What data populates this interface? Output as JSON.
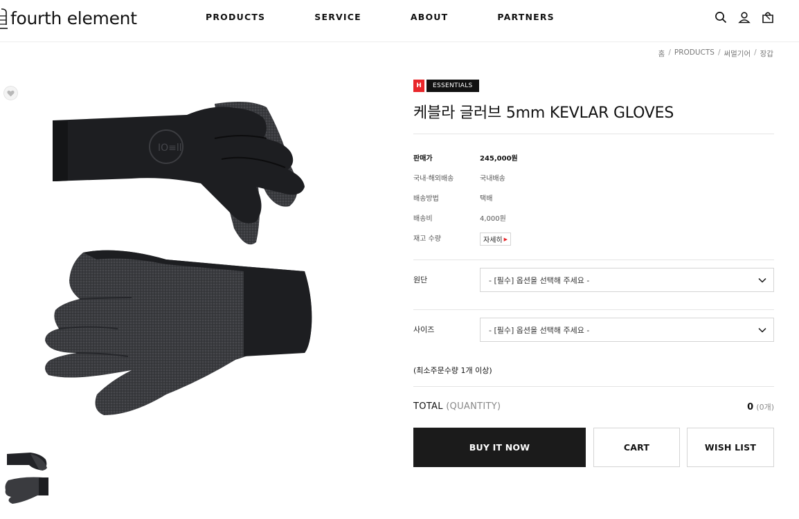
{
  "header": {
    "logo": "fourth element",
    "nav": [
      "PRODUCTS",
      "SERVICE",
      "ABOUT",
      "PARTNERS"
    ],
    "icons": [
      "search-icon",
      "user-icon",
      "bag-icon"
    ]
  },
  "breadcrumb": [
    "홈",
    "PRODUCTS",
    "써멀기어",
    "장갑"
  ],
  "product": {
    "badge_h": "H",
    "badge_tag": "ESSENTIALS",
    "title": "케블라 글러브 5mm KEVLAR GLOVES",
    "specs": [
      {
        "key": "판매가",
        "value": "245,000원"
      },
      {
        "key": "국내·해외배송",
        "value": "국내배송"
      },
      {
        "key": "배송방법",
        "value": "택배"
      },
      {
        "key": "배송비",
        "value": "4,000원"
      },
      {
        "key": "재고 수량",
        "value": "자세히"
      }
    ],
    "options": [
      {
        "label": "원단",
        "placeholder": "- [필수] 옵션을 선택해 주세요 -"
      },
      {
        "label": "사이즈",
        "placeholder": "- [필수] 옵션을 선택해 주세요 -"
      }
    ],
    "min_order": "(최소주문수량 1개 이상)",
    "total": {
      "label": "TOTAL",
      "quantity_label": "(QUANTITY)",
      "value": "0",
      "count": "(0개)"
    },
    "buttons": {
      "buy": "BUY IT NOW",
      "cart": "CART",
      "wish": "WISH LIST"
    }
  },
  "colors": {
    "accent_red": "#e8262a",
    "dark": "#1b1b1b",
    "border": "#d4d4d4"
  }
}
